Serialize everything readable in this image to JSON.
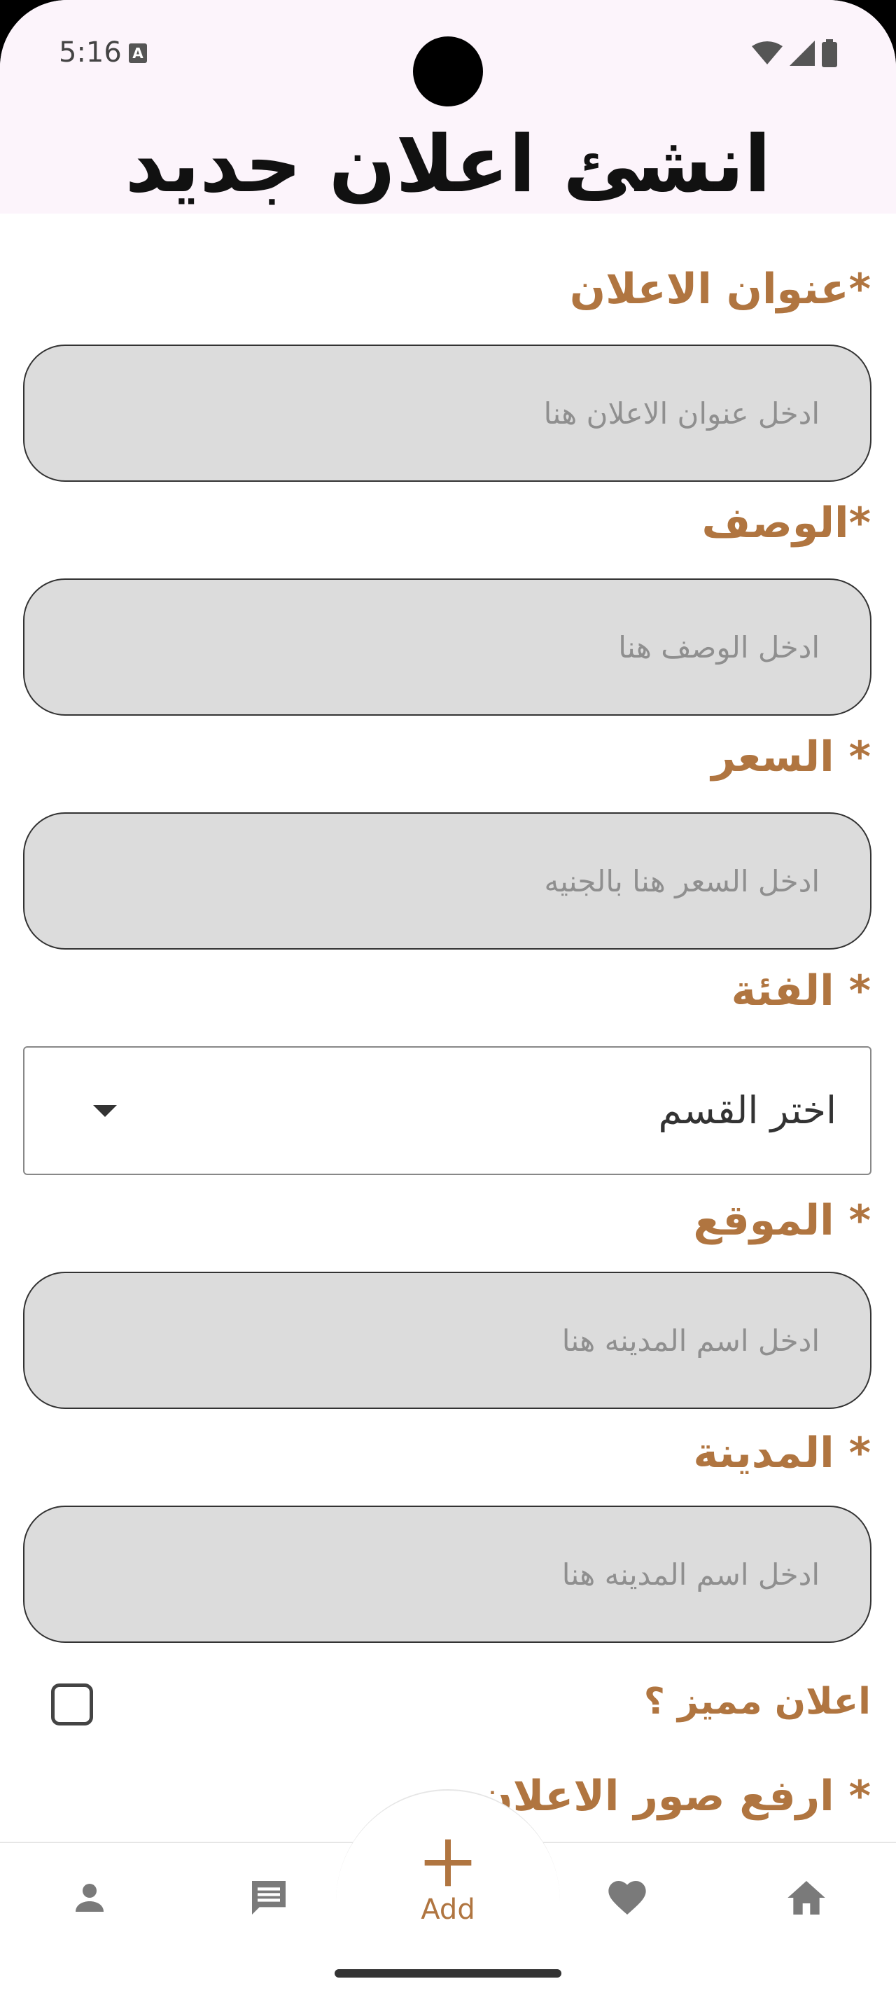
{
  "status_bar": {
    "time": "5:16",
    "a_icon": "A"
  },
  "page": {
    "title": "انشئ اعلان جديد"
  },
  "fields": [
    {
      "label": "*عنوان الاعلان",
      "placeholder": "ادخل عنوان الاعلان هنا"
    },
    {
      "label": "*الوصف",
      "placeholder": "ادخل الوصف هنا"
    },
    {
      "label": "* السعر",
      "placeholder": "ادخل السعر هنا بالجنيه"
    }
  ],
  "category": {
    "label": "* الفئة",
    "selected": "اختر القسم"
  },
  "location": {
    "label": "* الموقع",
    "placeholder": "ادخل اسم المدينه هنا"
  },
  "city": {
    "label": "* المدينة",
    "placeholder": "ادخل اسم المدينه هنا"
  },
  "featured": {
    "label": "اعلان مميز ؟",
    "checked": false
  },
  "partial_label": "* ارفع صور الاعلان",
  "bottom_nav": {
    "add_label": "Add",
    "icons": [
      "person-icon",
      "chat-icon",
      "add-icon",
      "heart-icon",
      "home-icon"
    ],
    "accent": "#b07540",
    "icon_color": "#7a7a7a"
  },
  "colors": {
    "label": "#b07540",
    "field_bg": "#dcdcdc",
    "header_bg": "#fcf4fb"
  }
}
